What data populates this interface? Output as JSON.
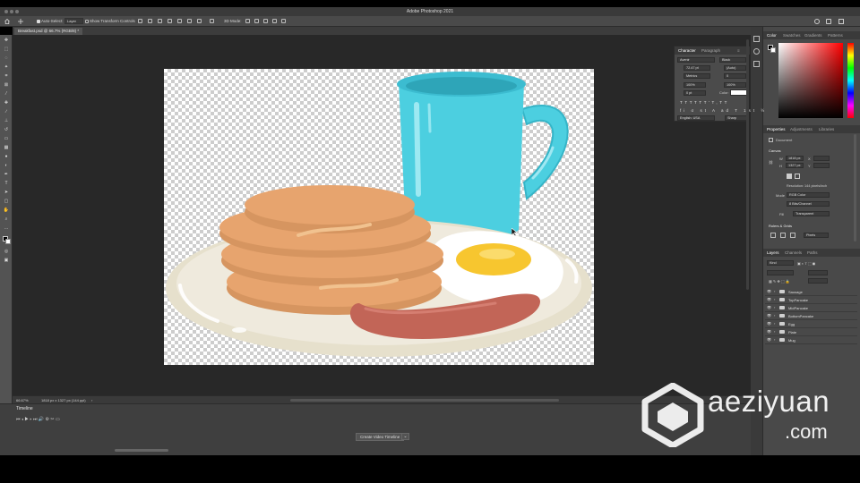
{
  "window": {
    "title": "Adobe Photoshop 2021"
  },
  "options_bar": {
    "auto_select_label": "Auto-Select:",
    "auto_select_value": "Layer",
    "show_transform_label": "Show Transform Controls",
    "mode_3d_label": "3D Mode:"
  },
  "document": {
    "tab_label": "Breakfast.psd @ 66.7% (RGB/8) *"
  },
  "status_bar": {
    "zoom": "66.67%",
    "doc_info": "1818 px x 1327 px (144 ppi)"
  },
  "timeline": {
    "panel_label": "Timeline",
    "create_button": "Create Video Timeline"
  },
  "character_panel": {
    "tabs": [
      "Character",
      "Paragraph"
    ],
    "font_family": "Avenir",
    "font_style": "Black",
    "font_size": "72.47 pt",
    "leading": "(Auto)",
    "kerning": "Metrics",
    "tracking": "0",
    "vertical_scale": "100%",
    "horizontal_scale": "100%",
    "baseline_shift": "0 pt",
    "color_label": "Color:",
    "language": "English: USA",
    "antialias": "Sharp"
  },
  "color_panel": {
    "tabs": [
      "Color",
      "Swatches",
      "Gradients",
      "Patterns"
    ]
  },
  "properties_panel": {
    "tabs": [
      "Properties",
      "Adjustments",
      "Libraries"
    ],
    "section_document": "Document",
    "section_canvas": "Canvas",
    "width": "1818 px",
    "height": "1327 px",
    "x_label": "X",
    "y_label": "Y",
    "resolution": "Resolution: 144 pixels/inch",
    "mode_label": "Mode",
    "mode_value": "RGB Color",
    "bit_depth": "8 Bits/Channel",
    "fill_label": "Fill",
    "fill_value": "Transparent",
    "rulers_grids": "Rulers & Grids",
    "units": "Pixels"
  },
  "layers_panel": {
    "tabs": [
      "Layers",
      "Channels",
      "Paths"
    ],
    "filter_kind": "Kind",
    "layers": [
      {
        "name": "Sausage"
      },
      {
        "name": "TopPancake"
      },
      {
        "name": "MidPancake"
      },
      {
        "name": "BottomPancake"
      },
      {
        "name": "Egg"
      },
      {
        "name": "Plate"
      },
      {
        "name": "Mug"
      }
    ]
  },
  "watermark": {
    "line1": "aeziyuan",
    "line2": ".com"
  },
  "colors": {
    "mug": "#4ccfe0",
    "pancake": "#e7a46e",
    "yolk": "#f7c62f",
    "sausage": "#c26557",
    "plate": "#efeadd",
    "app_bg": "#282828"
  }
}
